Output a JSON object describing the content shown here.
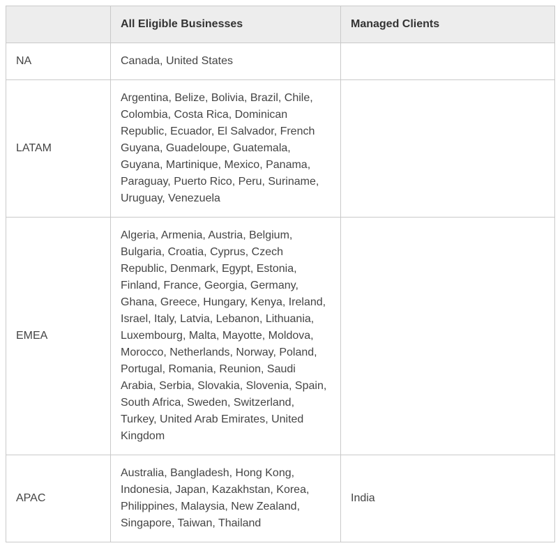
{
  "table": {
    "headers": {
      "region": "",
      "all_eligible": "All Eligible Businesses",
      "managed": "Managed Clients"
    },
    "rows": [
      {
        "region": "NA",
        "all_eligible": "Canada, United States",
        "managed": ""
      },
      {
        "region": "LATAM",
        "all_eligible": "Argentina, Belize, Bolivia, Brazil, Chile, Colombia, Costa Rica, Dominican Republic, Ecuador, El Salvador, French Guyana, Guadeloupe, Guatemala, Guyana, Martinique, Mexico, Panama, Paraguay, Puerto Rico, Peru, Suriname, Uruguay, Venezuela",
        "managed": ""
      },
      {
        "region": "EMEA",
        "all_eligible": "Algeria, Armenia, Austria, Belgium, Bulgaria, Croatia, Cyprus, Czech Republic, Denmark, Egypt, Estonia, Finland, France, Georgia, Germany, Ghana, Greece, Hungary, Kenya, Ireland, Israel, Italy, Latvia, Lebanon, Lithuania, Luxembourg, Malta, Mayotte, Moldova, Morocco, Netherlands, Norway, Poland, Portugal, Romania, Reunion, Saudi Arabia, Serbia, Slovakia, Slovenia, Spain, South Africa, Sweden, Switzerland, Turkey, United Arab Emirates, United Kingdom",
        "managed": ""
      },
      {
        "region": "APAC",
        "all_eligible": "Australia, Bangladesh, Hong Kong, Indonesia, Japan, Kazakhstan, Korea, Philippines, Malaysia, New Zealand, Singapore, Taiwan, Thailand",
        "managed": "India"
      }
    ]
  }
}
